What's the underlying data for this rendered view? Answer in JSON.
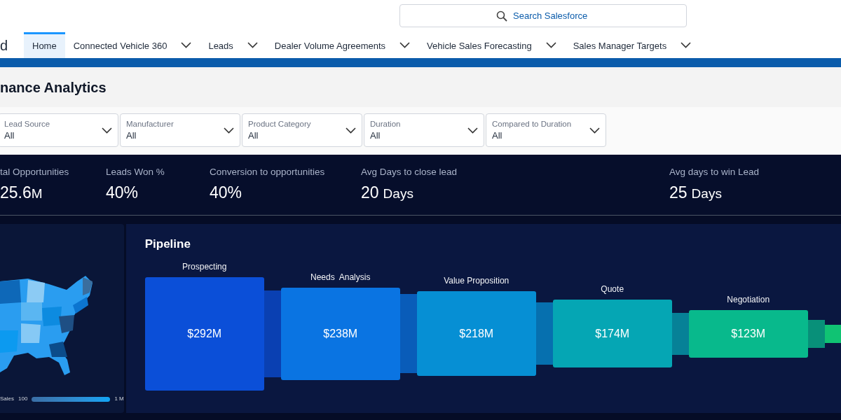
{
  "header": {
    "logo_text": "d",
    "search": {
      "placeholder": "Search Salesforce"
    }
  },
  "nav_tabs": [
    {
      "label": "Home",
      "selected": true,
      "has_menu": false
    },
    {
      "label": "Connected Vehicle 360",
      "selected": false,
      "has_menu": true
    },
    {
      "label": "Leads",
      "selected": false,
      "has_menu": true
    },
    {
      "label": "Dealer Volume Agreements",
      "selected": false,
      "has_menu": true
    },
    {
      "label": "Vehicle Sales Forecasting",
      "selected": false,
      "has_menu": true
    },
    {
      "label": "Sales Manager Targets",
      "selected": false,
      "has_menu": true
    }
  ],
  "page_title": "nance Analytics",
  "filters": [
    {
      "label": "Lead Source",
      "value": "All"
    },
    {
      "label": "Manufacturer",
      "value": "All"
    },
    {
      "label": "Product Category",
      "value": "All"
    },
    {
      "label": "Duration",
      "value": "All"
    },
    {
      "label": "Compared to Duration",
      "value": "All"
    }
  ],
  "kpis": [
    {
      "label": "tal Opportunities",
      "value": "25.6",
      "unit": "M"
    },
    {
      "label": "Leads Won %",
      "value": "40%"
    },
    {
      "label": "Conversion to opportunities",
      "value": "40%"
    },
    {
      "label": "Avg Days to close lead",
      "value": "20",
      "unit": "Days"
    },
    {
      "label": "Avg days to win Lead",
      "value": "25",
      "unit": "Days"
    }
  ],
  "map_panel": {
    "legend_label": "Sales",
    "legend_min": "100",
    "legend_max": "1 M"
  },
  "pipeline": {
    "title": "Pipeline",
    "stages": [
      {
        "label": "Prospecting",
        "value": "$292M",
        "color": "#0b4fd8"
      },
      {
        "label": "Needs  Analysis",
        "value": "$238M",
        "color": "#0a74e2"
      },
      {
        "label": "Value Proposition",
        "value": "$218M",
        "color": "#068fd4"
      },
      {
        "label": "Quote",
        "value": "$174M",
        "color": "#05a6b4"
      },
      {
        "label": "Negotiation",
        "value": "$123M",
        "color": "#08b98c"
      }
    ]
  }
}
